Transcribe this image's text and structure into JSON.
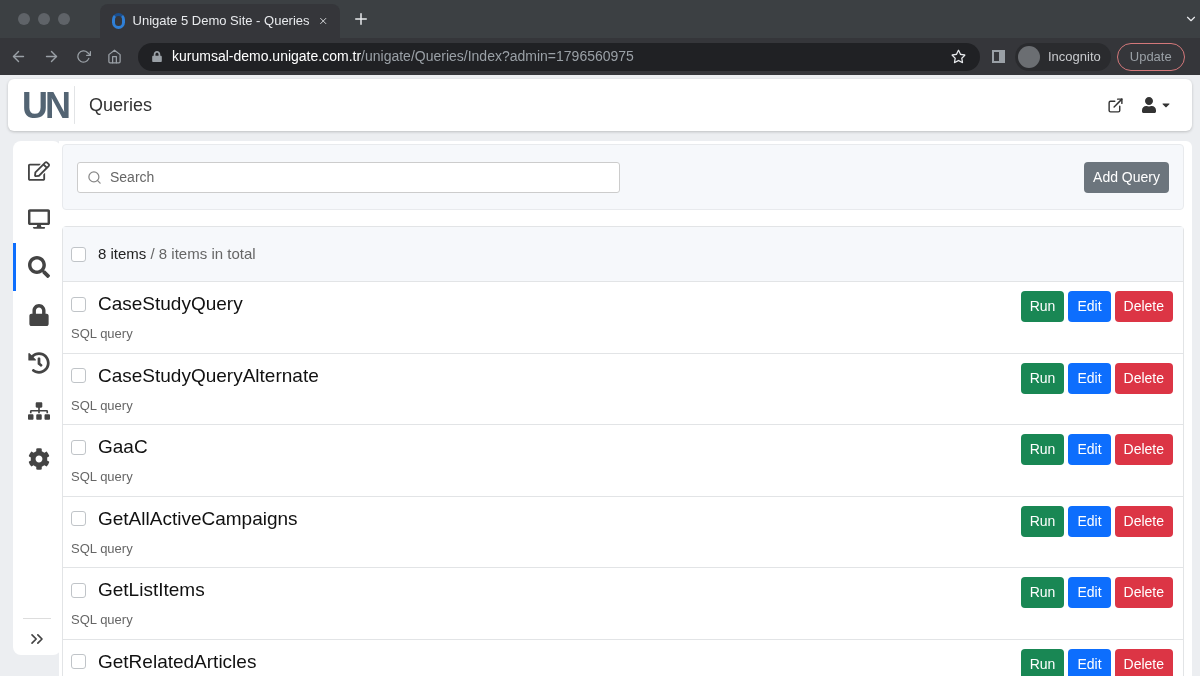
{
  "browser": {
    "tab_title": "Unigate 5 Demo Site - Queries",
    "url_host": "kurumsal-demo.unigate.com.tr",
    "url_path": "/unigate/Queries/Index?admin=1796560975",
    "profile": "Incognito",
    "update_label": "Update"
  },
  "header": {
    "logo": "UN",
    "title": "Queries"
  },
  "sidebar": {
    "items": [
      {
        "kind": "edit",
        "selected": false
      },
      {
        "kind": "desktop",
        "selected": false
      },
      {
        "kind": "search",
        "selected": true
      },
      {
        "kind": "lock",
        "selected": false
      },
      {
        "kind": "history",
        "selected": false
      },
      {
        "kind": "sitemap",
        "selected": false
      },
      {
        "kind": "settings",
        "selected": false
      }
    ]
  },
  "toolbar": {
    "search_placeholder": "Search",
    "add_button": "Add Query"
  },
  "list": {
    "select_all_checked": false,
    "count": "8 items",
    "total": " / 8 items in total",
    "rows": [
      {
        "name": "CaseStudyQuery",
        "type": "SQL query",
        "checked": false,
        "actions": [
          "Run",
          "Edit",
          "Delete"
        ]
      },
      {
        "name": "CaseStudyQueryAlternate",
        "type": "SQL query",
        "checked": false,
        "actions": [
          "Run",
          "Edit",
          "Delete"
        ]
      },
      {
        "name": "GaaC",
        "type": "SQL query",
        "checked": false,
        "actions": [
          "Run",
          "Edit",
          "Delete"
        ]
      },
      {
        "name": "GetAllActiveCampaigns",
        "type": "SQL query",
        "checked": false,
        "actions": [
          "Run",
          "Edit",
          "Delete"
        ]
      },
      {
        "name": "GetListItems",
        "type": "SQL query",
        "checked": false,
        "actions": [
          "Run",
          "Edit",
          "Delete"
        ]
      },
      {
        "name": "GetRelatedArticles",
        "checked": false,
        "actions": [
          "Run",
          "Edit",
          "Delete"
        ]
      }
    ]
  }
}
